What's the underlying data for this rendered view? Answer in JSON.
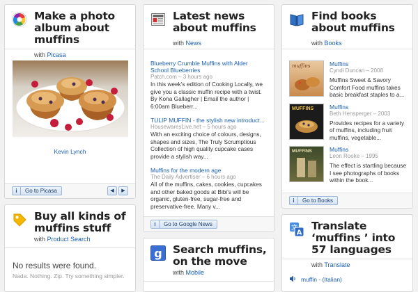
{
  "photo": {
    "title": "Make a photo album about muffins",
    "with_prefix": "with",
    "with_link": "Picasa",
    "caption": "Kevin Lynch",
    "go_label": "Go to Picasa",
    "prev_label": "◀",
    "next_label": "▶"
  },
  "news": {
    "title": "Latest news about muffins",
    "with_prefix": "with",
    "with_link": "News",
    "go_label": "Go to Google News",
    "items": [
      {
        "title": "Blueberry Crumble Muffins with Alder School Blueberries",
        "source": "Patch.com – 3 hours ago",
        "body": "In this week's edition of Cooking Locally, we give you a classic muffin recipe with a twist. By Kona Gallagher | Email the author | 6:00am Blueberr..."
      },
      {
        "title": "TULIP MUFFIN - the stylish new introduct...",
        "source": "HousewaresLive.net – 5 hours ago",
        "body": "With an exciting choice of colours, designs, shapes and sizes, The Truly Scrumptious Collection of high quality cupcake cases provide a stylish way..."
      },
      {
        "title": "Muffins for the modern age",
        "source": "The Daily Advertiser – 6 hours ago",
        "body": "All of the muffins, cakes, cookies, cupcakes and other baked goods at Bibi's will be organic, gluten-free, sugar-free and preservative-free. Many v..."
      }
    ]
  },
  "books": {
    "title": "Find books about muffins",
    "with_prefix": "with",
    "with_link": "Books",
    "go_label": "Go to Books",
    "items": [
      {
        "title": "Muffins",
        "meta": "Cyndi Duncan – 2008",
        "desc": "Muffins Sweet & Savory Comfort Food muffins takes basic breakfast staples to a...",
        "cover_text": "muffins"
      },
      {
        "title": "Muffins",
        "meta": "Beth Hensperger – 2003",
        "desc": "Provides recipes for a variety of muffins, including fruit muffins, vegetable...",
        "cover_text": "MUFFINS"
      },
      {
        "title": "Muffins",
        "meta": "Leon Rooke – 1995",
        "desc": "The effect is startling because I see photographs of books within the book...",
        "cover_text": "MUFFINS"
      }
    ]
  },
  "shop": {
    "title": "Buy all kinds of muffins stuff",
    "with_prefix": "with",
    "with_link": "Product Search",
    "no_results": "No results were found.",
    "no_results_sub": "Nada. Nothing. Zip. Try something simpler."
  },
  "mobile": {
    "title": "Search muffins, on the move",
    "with_prefix": "with",
    "with_link": "Mobile"
  },
  "translate": {
    "title": "Translate ‘muffins ’ into 57 languages",
    "with_prefix": "with",
    "with_link": "Translate",
    "first_item": "muffin - (Italian)"
  },
  "colors": {
    "link": "#1a5fb4",
    "page_bg": "#f2f2f2",
    "card_border": "#d7d7d7"
  }
}
